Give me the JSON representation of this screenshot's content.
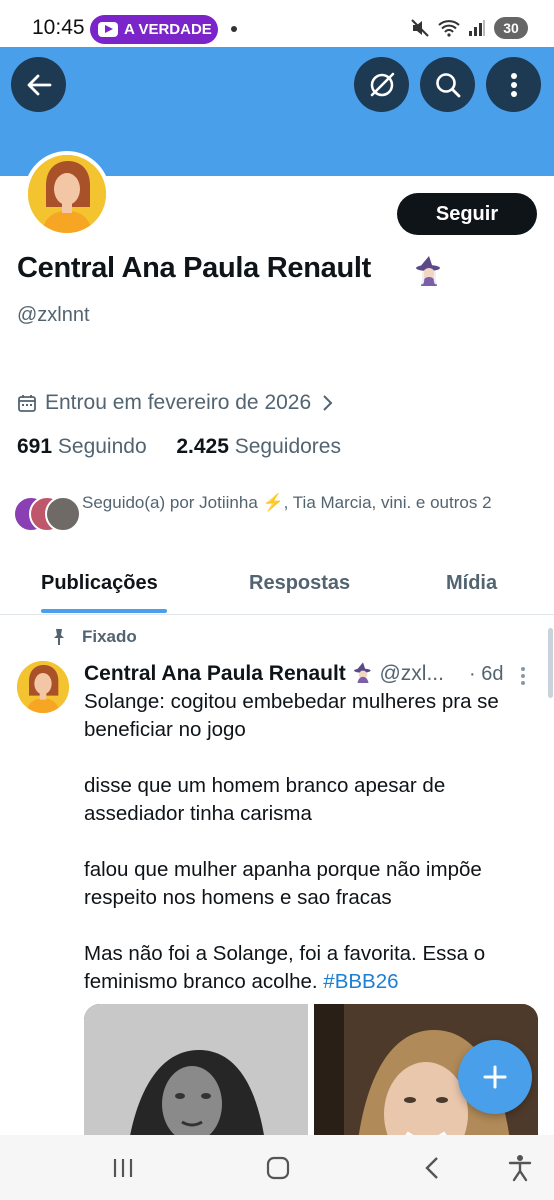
{
  "status_bar": {
    "time": "10:45",
    "notification_pill": "A VERDADE",
    "battery": "30"
  },
  "profile": {
    "name": "Central Ana Paula Renault",
    "handle": "@zxlnnt",
    "follow_label": "Seguir",
    "joined": "Entrou em fevereiro de 2026",
    "following_count": "691",
    "following_label": "Seguindo",
    "followers_count": "2.425",
    "followers_label": "Seguidores",
    "followed_by": "Seguido(a) por Jotiinha ⚡️, Tia Marcia, vini. e outros 2"
  },
  "tabs": [
    "Publicações",
    "Respostas",
    "Mídia"
  ],
  "pinned_tweet": {
    "pinned_label": "Fixado",
    "author_name": "Central Ana Paula Renault",
    "author_handle": "@zxl...",
    "time": "· 6d",
    "paragraphs": [
      "Solange: cogitou embebedar mulheres pra se beneficiar no jogo",
      "disse que um homem branco apesar de assediador tinha carisma",
      "falou que mulher apanha porque não impõe respeito nos homens e sao fracas"
    ],
    "last_paragraph": "Mas não foi a Solange, foi a favorita. Essa o feminismo branco acolhe. ",
    "hashtag": "#BBB26"
  },
  "colors": {
    "banner": "#4a9fea",
    "accent": "#1d9bf0",
    "pill": "#7b24c9"
  },
  "icons": [
    "back-arrow-icon",
    "grok-icon",
    "search-icon",
    "more-vertical-icon",
    "calendar-icon",
    "chevron-right-icon",
    "pin-icon",
    "plus-icon",
    "witch-emoji"
  ]
}
